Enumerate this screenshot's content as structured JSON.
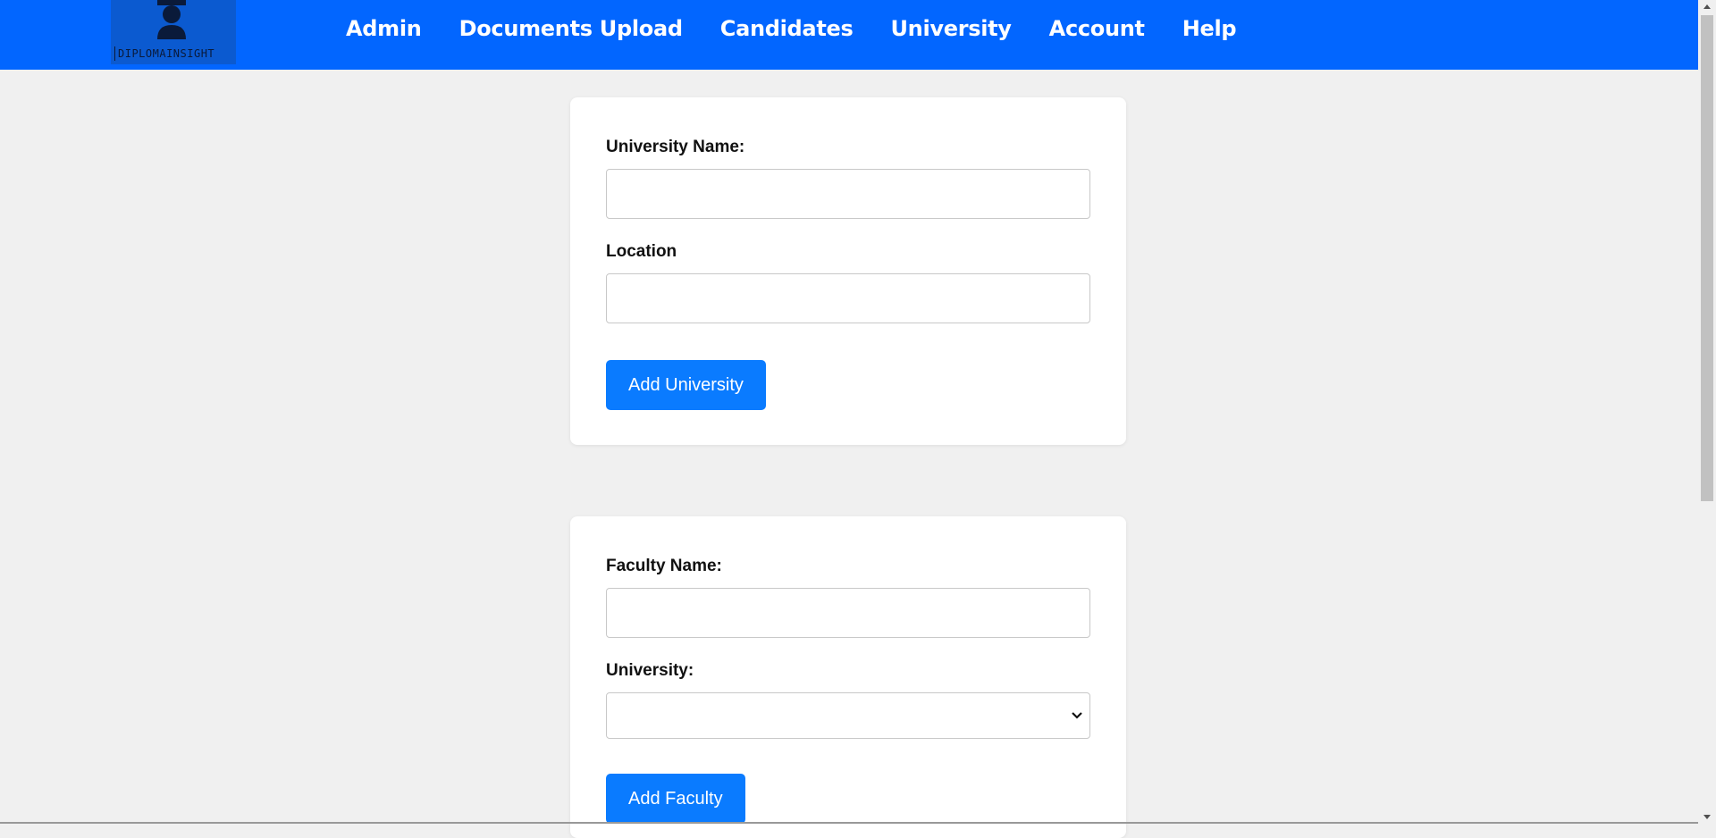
{
  "navbar": {
    "logo_text": "DIPLOMAINSIGHT",
    "logo_icon": "graduate-cap-icon",
    "links": [
      "Admin",
      "Documents Upload",
      "Candidates",
      "University",
      "Account",
      "Help"
    ],
    "background": "#0266ff"
  },
  "university_form": {
    "name_label": "University Name:",
    "name_value": "",
    "location_label": "Location",
    "location_value": "",
    "submit_label": "Add University"
  },
  "faculty_form": {
    "name_label": "Faculty Name:",
    "name_value": "",
    "university_label": "University:",
    "university_selected": "",
    "submit_label": "Add Faculty"
  },
  "colors": {
    "accent": "#0a7bff",
    "page_background": "#f0f0f0"
  }
}
